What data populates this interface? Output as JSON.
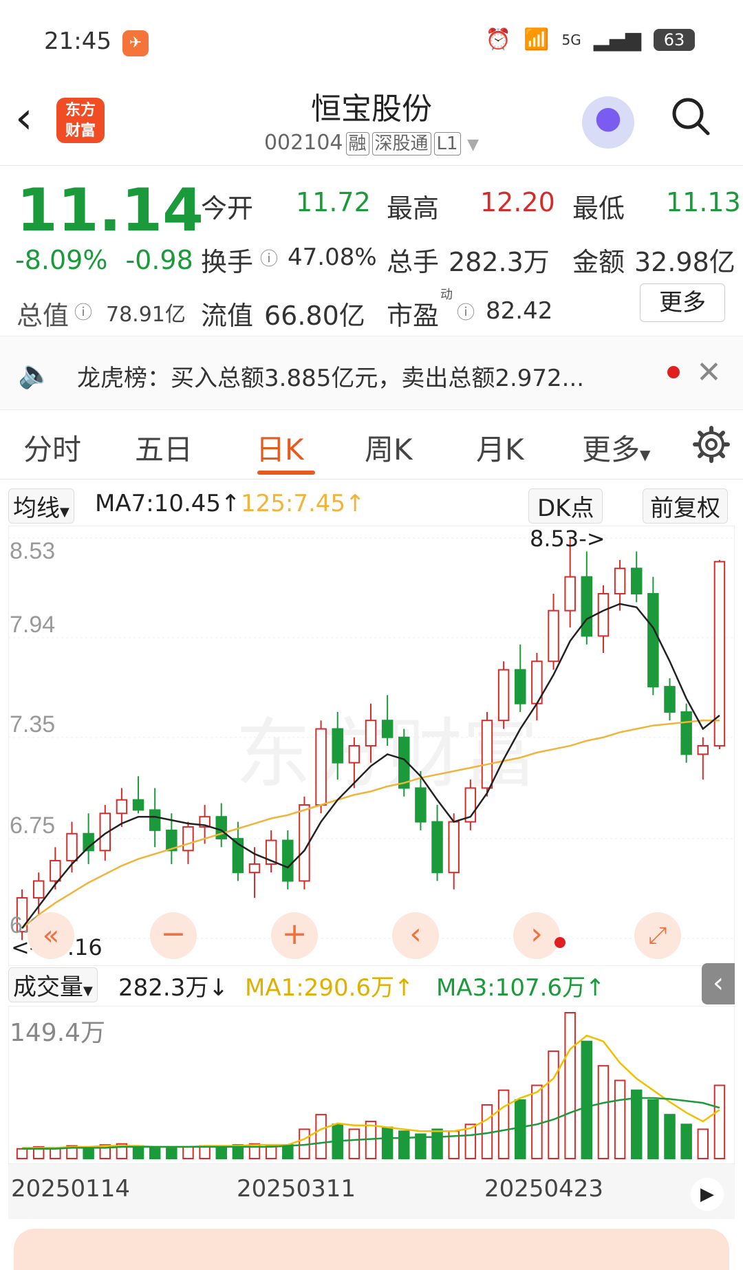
{
  "status": {
    "time": "21:45",
    "battery": "63",
    "signal": "5G"
  },
  "header": {
    "title": "恒宝股份",
    "code": "002104",
    "tags": [
      "融",
      "深股通",
      "L1"
    ]
  },
  "quote": {
    "price": "11.14",
    "pct": "-8.09%",
    "chg": "-0.98",
    "rows": [
      [
        {
          "label": "今开",
          "value": "11.72",
          "color": "green"
        },
        {
          "label": "最高",
          "value": "12.20",
          "color": "red"
        },
        {
          "label": "最低",
          "value": "11.13",
          "color": "green"
        }
      ],
      [
        {
          "label": "换手",
          "value": "47.08%",
          "color": "dark"
        },
        {
          "label": "总手",
          "value": "282.3万",
          "color": "dark"
        },
        {
          "label": "金额",
          "value": "32.98亿",
          "color": "dark"
        }
      ],
      [
        {
          "label": "流值",
          "value": "66.80亿",
          "color": "dark"
        },
        {
          "label": "市盈",
          "value": "82.42",
          "color": "dark"
        }
      ]
    ],
    "total_label": "总值",
    "total_value": "78.91亿",
    "pe_sup": "动",
    "more": "更多"
  },
  "banner": {
    "text": "龙虎榜：买入总额3.885亿元，卖出总额2.972..."
  },
  "tabs": {
    "items": [
      "分时",
      "五日",
      "日K",
      "周K",
      "月K",
      "更多"
    ],
    "active": 2
  },
  "kline": {
    "ma_select": "均线",
    "ma7": "MA7:10.45↑",
    "ma125": "125:7.45↑",
    "dk": "DK点",
    "adjust": "前复权",
    "y_labels": [
      "8.53",
      "7.94",
      "7.35",
      "6.75",
      "6.16"
    ],
    "high_note": "8.53->",
    "low_note": "<---6.16"
  },
  "volume": {
    "select": "成交量",
    "value": "282.3万↓",
    "ma1": "MA1:290.6万↑",
    "ma3": "MA3:107.6万↑",
    "max_label": "149.4万"
  },
  "x_labels": [
    "20250114",
    "20250311",
    "20250423"
  ],
  "colors": {
    "up": "#d62b2b",
    "down": "#1a9a3a",
    "ma7": "#222222",
    "ma125": "#f0b43a",
    "vma1": "#f0c000",
    "vma3": "#1a9a3a"
  },
  "chart_data": {
    "type": "candlestick",
    "candles": [
      [
        6.2,
        6.45,
        6.15,
        6.4
      ],
      [
        6.4,
        6.55,
        6.3,
        6.5
      ],
      [
        6.5,
        6.7,
        6.45,
        6.62
      ],
      [
        6.62,
        6.85,
        6.55,
        6.78
      ],
      [
        6.78,
        6.9,
        6.6,
        6.68
      ],
      [
        6.68,
        6.95,
        6.62,
        6.9
      ],
      [
        6.9,
        7.05,
        6.82,
        6.98
      ],
      [
        6.98,
        7.12,
        6.9,
        6.92
      ],
      [
        6.92,
        7.05,
        6.7,
        6.8
      ],
      [
        6.8,
        6.9,
        6.6,
        6.68
      ],
      [
        6.68,
        6.85,
        6.6,
        6.82
      ],
      [
        6.82,
        6.95,
        6.72,
        6.88
      ],
      [
        6.88,
        6.96,
        6.7,
        6.75
      ],
      [
        6.75,
        6.85,
        6.5,
        6.55
      ],
      [
        6.55,
        6.7,
        6.4,
        6.6
      ],
      [
        6.6,
        6.8,
        6.55,
        6.74
      ],
      [
        6.74,
        6.8,
        6.45,
        6.5
      ],
      [
        6.5,
        7.0,
        6.45,
        6.95
      ],
      [
        6.95,
        7.45,
        6.9,
        7.4
      ],
      [
        7.4,
        7.5,
        7.1,
        7.2
      ],
      [
        7.2,
        7.35,
        7.05,
        7.3
      ],
      [
        7.3,
        7.55,
        7.2,
        7.45
      ],
      [
        7.45,
        7.6,
        7.3,
        7.35
      ],
      [
        7.35,
        7.4,
        7.0,
        7.05
      ],
      [
        7.05,
        7.15,
        6.8,
        6.85
      ],
      [
        6.85,
        6.95,
        6.5,
        6.55
      ],
      [
        6.55,
        6.9,
        6.45,
        6.85
      ],
      [
        6.85,
        7.1,
        6.8,
        7.05
      ],
      [
        7.05,
        7.5,
        7.0,
        7.45
      ],
      [
        7.45,
        7.8,
        7.4,
        7.75
      ],
      [
        7.75,
        7.9,
        7.5,
        7.55
      ],
      [
        7.55,
        7.85,
        7.45,
        7.8
      ],
      [
        7.8,
        8.2,
        7.75,
        8.1
      ],
      [
        8.1,
        8.53,
        8.0,
        8.3
      ],
      [
        8.3,
        8.45,
        7.9,
        7.95
      ],
      [
        7.95,
        8.25,
        7.85,
        8.2
      ],
      [
        8.2,
        8.4,
        8.1,
        8.35
      ],
      [
        8.35,
        8.45,
        8.15,
        8.2
      ],
      [
        8.2,
        8.3,
        7.6,
        7.65
      ],
      [
        7.65,
        7.7,
        7.45,
        7.5
      ],
      [
        7.5,
        7.55,
        7.2,
        7.25
      ],
      [
        7.25,
        7.35,
        7.1,
        7.3
      ],
      [
        7.3,
        8.4,
        7.28,
        8.39
      ]
    ],
    "ma7": [
      6.22,
      6.35,
      6.48,
      6.6,
      6.7,
      6.78,
      6.84,
      6.88,
      6.88,
      6.86,
      6.84,
      6.83,
      6.8,
      6.72,
      6.66,
      6.62,
      6.58,
      6.68,
      6.85,
      6.98,
      7.08,
      7.18,
      7.25,
      7.22,
      7.12,
      6.98,
      6.85,
      6.88,
      7.02,
      7.22,
      7.4,
      7.55,
      7.72,
      7.92,
      8.05,
      8.1,
      8.14,
      8.12,
      8.0,
      7.8,
      7.58,
      7.4,
      7.48
    ],
    "ma125": [
      6.22,
      6.3,
      6.37,
      6.43,
      6.49,
      6.54,
      6.59,
      6.63,
      6.66,
      6.69,
      6.72,
      6.75,
      6.78,
      6.81,
      6.84,
      6.87,
      6.89,
      6.92,
      6.95,
      6.98,
      7.01,
      7.03,
      7.06,
      7.08,
      7.11,
      7.13,
      7.15,
      7.17,
      7.19,
      7.21,
      7.23,
      7.26,
      7.28,
      7.3,
      7.33,
      7.35,
      7.38,
      7.4,
      7.42,
      7.43,
      7.44,
      7.45,
      7.45
    ],
    "volume": [
      10,
      12,
      11,
      13,
      12,
      14,
      15,
      13,
      12,
      11,
      12,
      13,
      12,
      14,
      15,
      13,
      14,
      30,
      45,
      35,
      30,
      38,
      32,
      28,
      25,
      30,
      28,
      35,
      55,
      70,
      60,
      75,
      110,
      149.4,
      120,
      95,
      80,
      70,
      60,
      45,
      35,
      30,
      75
    ],
    "vma1": [
      11,
      11,
      11,
      12,
      12,
      13,
      13,
      13,
      12,
      12,
      12,
      13,
      13,
      13,
      14,
      14,
      14,
      20,
      30,
      36,
      34,
      34,
      32,
      30,
      28,
      28,
      28,
      31,
      40,
      53,
      62,
      68,
      82,
      112,
      126,
      120,
      98,
      82,
      70,
      58,
      47,
      38,
      50
    ],
    "vma3": [
      10,
      10,
      10,
      11,
      11,
      11,
      12,
      12,
      12,
      12,
      12,
      12,
      12,
      12,
      12,
      12,
      13,
      14,
      16,
      18,
      19,
      20,
      21,
      21,
      22,
      22,
      23,
      24,
      26,
      29,
      32,
      35,
      40,
      47,
      53,
      57,
      60,
      62,
      62,
      61,
      59,
      57,
      52
    ],
    "ylim": [
      6.16,
      8.53
    ],
    "vmax": 149.4
  }
}
